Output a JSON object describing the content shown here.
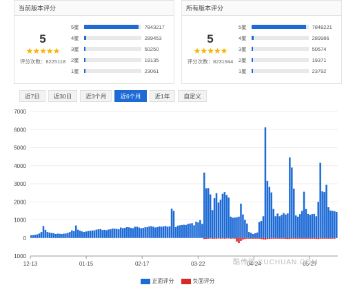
{
  "current_version": {
    "title": "当前版本评分",
    "score": "5",
    "stars": "★★★★★",
    "rating_count_text": "评分次数：8225118",
    "rows": [
      {
        "label": "5星",
        "value": "7843217",
        "fraction": 0.9535
      },
      {
        "label": "4星",
        "value": "289453",
        "fraction": 0.0352
      },
      {
        "label": "3星",
        "value": "50250",
        "fraction": 0.0061
      },
      {
        "label": "2星",
        "value": "19135",
        "fraction": 0.0023
      },
      {
        "label": "1星",
        "value": "23061",
        "fraction": 0.0028
      }
    ]
  },
  "all_versions": {
    "title": "所有版本评分",
    "score": "5",
    "stars": "★★★★★",
    "rating_count_text": "评分次数：8231944",
    "rows": [
      {
        "label": "5星",
        "value": "7848221",
        "fraction": 0.9534
      },
      {
        "label": "4星",
        "value": "289986",
        "fraction": 0.0352
      },
      {
        "label": "3星",
        "value": "50574",
        "fraction": 0.0061
      },
      {
        "label": "2星",
        "value": "19371",
        "fraction": 0.0024
      },
      {
        "label": "1星",
        "value": "23792",
        "fraction": 0.0029
      }
    ]
  },
  "tabs": [
    {
      "label": "近7日",
      "active": false
    },
    {
      "label": "近30日",
      "active": false
    },
    {
      "label": "近3个月",
      "active": false
    },
    {
      "label": "近6个月",
      "active": true
    },
    {
      "label": "近1年",
      "active": false
    },
    {
      "label": "自定义",
      "active": false
    }
  ],
  "watermark": "酷传网 KUCHUAN.COM",
  "colors": {
    "positive": "#1e6bd6",
    "negative": "#d62a2a",
    "tab_active": "#1e6bd6",
    "star": "#f5b400"
  },
  "chart_data": {
    "type": "bar",
    "yticks": [
      "7000",
      "6000",
      "5000",
      "4000",
      "3000",
      "2000",
      "1000",
      "0",
      "1000"
    ],
    "ylim": [
      -1000,
      7000
    ],
    "xticks": [
      "12-13",
      "01-15",
      "02-17",
      "03-22",
      "04-24",
      "05-27"
    ],
    "legend": [
      "正面评分",
      "负面评分"
    ],
    "legend_position": "bottom",
    "series": [
      {
        "name": "正面评分",
        "values": [
          150,
          160,
          180,
          200,
          250,
          330,
          660,
          450,
          330,
          300,
          280,
          260,
          220,
          240,
          230,
          220,
          240,
          250,
          280,
          330,
          420,
          380,
          690,
          460,
          400,
          360,
          330,
          360,
          380,
          400,
          410,
          420,
          460,
          480,
          490,
          440,
          450,
          430,
          470,
          480,
          520,
          510,
          500,
          480,
          580,
          540,
          560,
          600,
          590,
          560,
          540,
          620,
          620,
          580,
          540,
          560,
          590,
          600,
          640,
          650,
          620,
          580,
          600,
          640,
          620,
          640,
          660,
          620,
          640,
          1620,
          1500,
          600,
          680,
          700,
          720,
          730,
          720,
          780,
          800,
          820,
          700,
          900,
          860,
          980,
          780,
          3620,
          2750,
          2760,
          2410,
          1540,
          2200,
          2480,
          1960,
          2120,
          2440,
          2540,
          2380,
          2240,
          1180,
          1120,
          1130,
          1150,
          1180,
          1900,
          1300,
          1000,
          800,
          330,
          280,
          220,
          260,
          300,
          880,
          940,
          1200,
          6120,
          3160,
          2820,
          2520,
          1600,
          1200,
          1350,
          1200,
          1280,
          1380,
          1300,
          1360,
          4460,
          3900,
          2730,
          1250,
          1180,
          1320,
          1500,
          2560,
          1600,
          1330,
          1280,
          1320,
          1330,
          1200,
          2000,
          4160,
          2580,
          2540,
          2940,
          1700,
          1520,
          1500,
          1480,
          1440
        ]
      },
      {
        "name": "负面评分",
        "values": [
          0,
          0,
          0,
          0,
          0,
          0,
          0,
          0,
          0,
          0,
          0,
          0,
          0,
          0,
          0,
          0,
          0,
          0,
          0,
          0,
          0,
          0,
          0,
          0,
          0,
          0,
          0,
          0,
          0,
          0,
          0,
          0,
          0,
          0,
          0,
          0,
          0,
          0,
          0,
          0,
          0,
          0,
          0,
          0,
          0,
          0,
          0,
          0,
          0,
          0,
          0,
          0,
          0,
          0,
          0,
          0,
          0,
          0,
          0,
          0,
          0,
          0,
          0,
          0,
          0,
          0,
          0,
          0,
          0,
          0,
          0,
          0,
          0,
          0,
          0,
          0,
          0,
          0,
          0,
          0,
          0,
          0,
          0,
          0,
          0,
          -60,
          -50,
          -40,
          -30,
          -40,
          -40,
          -40,
          -30,
          -40,
          -30,
          -40,
          -30,
          -30,
          -40,
          -30,
          -40,
          -200,
          -280,
          -160,
          -90,
          -60,
          -40,
          -40,
          -40,
          -40,
          -40,
          -40,
          -40,
          -60,
          -80,
          -90,
          -60,
          -50,
          -40,
          -40,
          -40,
          -40,
          -40,
          -40,
          -40,
          -50,
          -60,
          -50,
          -40,
          -40,
          -40,
          -40,
          -40,
          -40,
          -40,
          -40,
          -40,
          -40,
          -40,
          -40,
          -50,
          -60,
          -40,
          -40,
          -40,
          -40,
          -40,
          -40,
          -40,
          -40
        ]
      }
    ]
  }
}
